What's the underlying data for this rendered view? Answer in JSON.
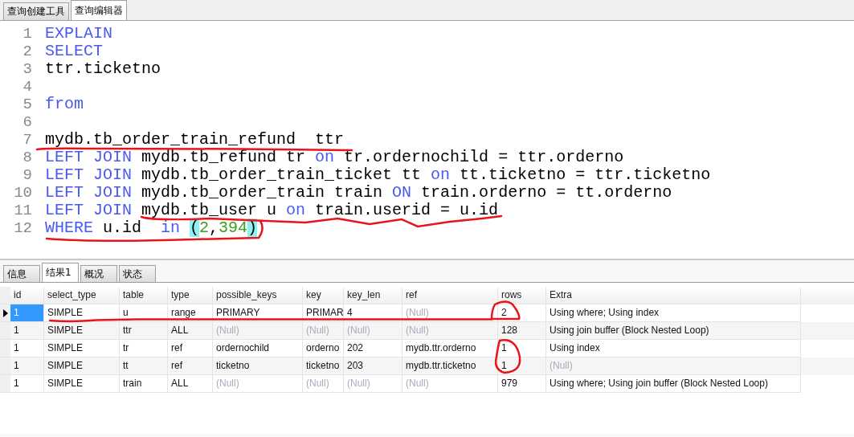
{
  "top_tabs": [
    {
      "label": "查询创建工具",
      "selected": false
    },
    {
      "label": "查询编辑器",
      "selected": true
    }
  ],
  "editor": {
    "lines": [
      {
        "number": "1",
        "tokens": [
          {
            "kind": "keyword",
            "text": "EXPLAIN"
          }
        ]
      },
      {
        "number": "2",
        "tokens": [
          {
            "kind": "keyword",
            "text": "SELECT"
          }
        ]
      },
      {
        "number": "3",
        "tokens": [
          {
            "kind": "text",
            "text": "ttr.ticketno"
          }
        ]
      },
      {
        "number": "4"
      },
      {
        "number": "5",
        "tokens": [
          {
            "kind": "keyword",
            "text": "from"
          }
        ]
      },
      {
        "number": "6"
      },
      {
        "number": "7",
        "tokens": [
          {
            "kind": "text",
            "text": "mydb.tb_order_train_refund  ttr"
          }
        ]
      },
      {
        "number": "8",
        "tokens": [
          {
            "kind": "keyword",
            "text": "LEFT JOIN"
          },
          {
            "kind": "text",
            "text": " mydb.tb_refund tr "
          },
          {
            "kind": "keyword",
            "text": "on"
          },
          {
            "kind": "text",
            "text": " tr.ordernochild = ttr.orderno"
          }
        ]
      },
      {
        "number": "9",
        "tokens": [
          {
            "kind": "keyword",
            "text": "LEFT JOIN"
          },
          {
            "kind": "text",
            "text": " mydb.tb_order_train_ticket tt "
          },
          {
            "kind": "keyword",
            "text": "on"
          },
          {
            "kind": "text",
            "text": " tt.ticketno = ttr.ticketno"
          }
        ]
      },
      {
        "number": "10",
        "tokens": [
          {
            "kind": "keyword",
            "text": "LEFT JOIN"
          },
          {
            "kind": "text",
            "text": " mydb.tb_order_train train "
          },
          {
            "kind": "keyword",
            "text": "ON"
          },
          {
            "kind": "text",
            "text": " train.orderno = tt.orderno"
          }
        ]
      },
      {
        "number": "11",
        "tokens": [
          {
            "kind": "keyword",
            "text": "LEFT JOIN"
          },
          {
            "kind": "text",
            "text": " mydb.tb_user u "
          },
          {
            "kind": "keyword",
            "text": "on"
          },
          {
            "kind": "text",
            "text": " train.userid = u.id"
          }
        ]
      },
      {
        "number": "12",
        "tokens": [
          {
            "kind": "keyword",
            "text": "WHERE"
          },
          {
            "kind": "text",
            "text": " u.id  "
          },
          {
            "kind": "keyword",
            "text": "in"
          },
          {
            "kind": "bracket",
            "text": "(",
            "space_before": true
          },
          {
            "kind": "number",
            "text": "2"
          },
          {
            "kind": "text",
            "text": ","
          },
          {
            "kind": "number",
            "text": "394"
          },
          {
            "kind": "bracket",
            "text": ")"
          }
        ]
      }
    ]
  },
  "result_tabs": [
    {
      "label": "信息",
      "selected": false
    },
    {
      "label": "结果1",
      "selected": true
    },
    {
      "label": "概况",
      "selected": false
    },
    {
      "label": "状态",
      "selected": false
    }
  ],
  "table": {
    "columns": [
      "id",
      "select_type",
      "table",
      "type",
      "possible_keys",
      "key",
      "key_len",
      "ref",
      "rows",
      "Extra"
    ],
    "rows": [
      {
        "selected": true,
        "cells": [
          {
            "text": "1",
            "null": false
          },
          {
            "text": "SIMPLE",
            "null": false
          },
          {
            "text": "u",
            "null": false
          },
          {
            "text": "range",
            "null": false
          },
          {
            "text": "PRIMARY",
            "null": false
          },
          {
            "text": "PRIMAR",
            "null": false
          },
          {
            "text": "4",
            "null": false
          },
          {
            "text": "(Null)",
            "null": true
          },
          {
            "text": "2",
            "null": false
          },
          {
            "text": "Using where; Using index",
            "null": false
          }
        ]
      },
      {
        "selected": false,
        "cells": [
          {
            "text": "1",
            "null": false
          },
          {
            "text": "SIMPLE",
            "null": false
          },
          {
            "text": "ttr",
            "null": false
          },
          {
            "text": "ALL",
            "null": false
          },
          {
            "text": "(Null)",
            "null": true
          },
          {
            "text": "(Null)",
            "null": true
          },
          {
            "text": "(Null)",
            "null": true
          },
          {
            "text": "(Null)",
            "null": true
          },
          {
            "text": "128",
            "null": false
          },
          {
            "text": "Using join buffer (Block Nested Loop)",
            "null": false
          }
        ]
      },
      {
        "selected": false,
        "cells": [
          {
            "text": "1",
            "null": false
          },
          {
            "text": "SIMPLE",
            "null": false
          },
          {
            "text": "tr",
            "null": false
          },
          {
            "text": "ref",
            "null": false
          },
          {
            "text": "ordernochild",
            "null": false
          },
          {
            "text": "orderno",
            "null": false
          },
          {
            "text": "202",
            "null": false
          },
          {
            "text": "mydb.ttr.orderno",
            "null": false
          },
          {
            "text": "1",
            "null": false
          },
          {
            "text": "Using index",
            "null": false
          }
        ]
      },
      {
        "selected": false,
        "cells": [
          {
            "text": "1",
            "null": false
          },
          {
            "text": "SIMPLE",
            "null": false
          },
          {
            "text": "tt",
            "null": false
          },
          {
            "text": "ref",
            "null": false
          },
          {
            "text": "ticketno",
            "null": false
          },
          {
            "text": "ticketno",
            "null": false
          },
          {
            "text": "203",
            "null": false
          },
          {
            "text": "mydb.ttr.ticketno",
            "null": false
          },
          {
            "text": "1",
            "null": false
          },
          {
            "text": "(Null)",
            "null": true
          }
        ]
      },
      {
        "selected": false,
        "cells": [
          {
            "text": "1",
            "null": false
          },
          {
            "text": "SIMPLE",
            "null": false
          },
          {
            "text": "train",
            "null": false
          },
          {
            "text": "ALL",
            "null": false
          },
          {
            "text": "(Null)",
            "null": true
          },
          {
            "text": "(Null)",
            "null": true
          },
          {
            "text": "(Null)",
            "null": true
          },
          {
            "text": "(Null)",
            "null": true
          },
          {
            "text": "979",
            "null": false
          },
          {
            "text": "Using where; Using join buffer (Block Nested Loop)",
            "null": false
          }
        ]
      }
    ]
  }
}
